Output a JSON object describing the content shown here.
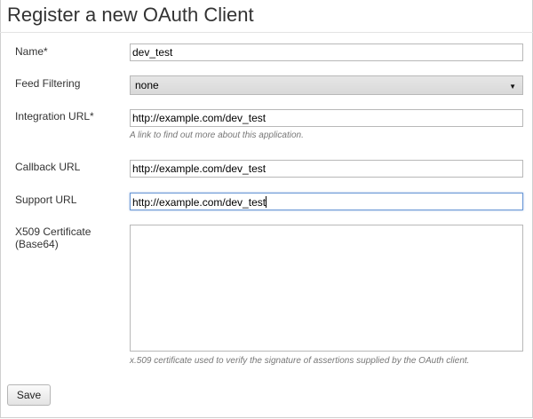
{
  "page": {
    "title": "Register a new OAuth Client"
  },
  "form": {
    "name": {
      "label": "Name*",
      "value": "dev_test"
    },
    "feed_filtering": {
      "label": "Feed Filtering",
      "selected": "none",
      "arrow_icon": "triangle-down"
    },
    "integration_url": {
      "label": "Integration URL*",
      "value": "http://example.com/dev_test",
      "help": "A link to find out more about this application."
    },
    "callback_url": {
      "label": "Callback URL",
      "value": "http://example.com/dev_test"
    },
    "support_url": {
      "label": "Support URL",
      "value": "http://example.com/dev_test",
      "focused": true
    },
    "certificate": {
      "label_line1": "X509 Certificate",
      "label_line2": "(Base64)",
      "value": "",
      "help": "x.509 certificate used to verify the signature of assertions supplied by the OAuth client."
    },
    "save_label": "Save"
  },
  "colors": {
    "focus_border": "#6a98d6",
    "help_text": "#777777",
    "select_background": "#dcdcdc"
  }
}
